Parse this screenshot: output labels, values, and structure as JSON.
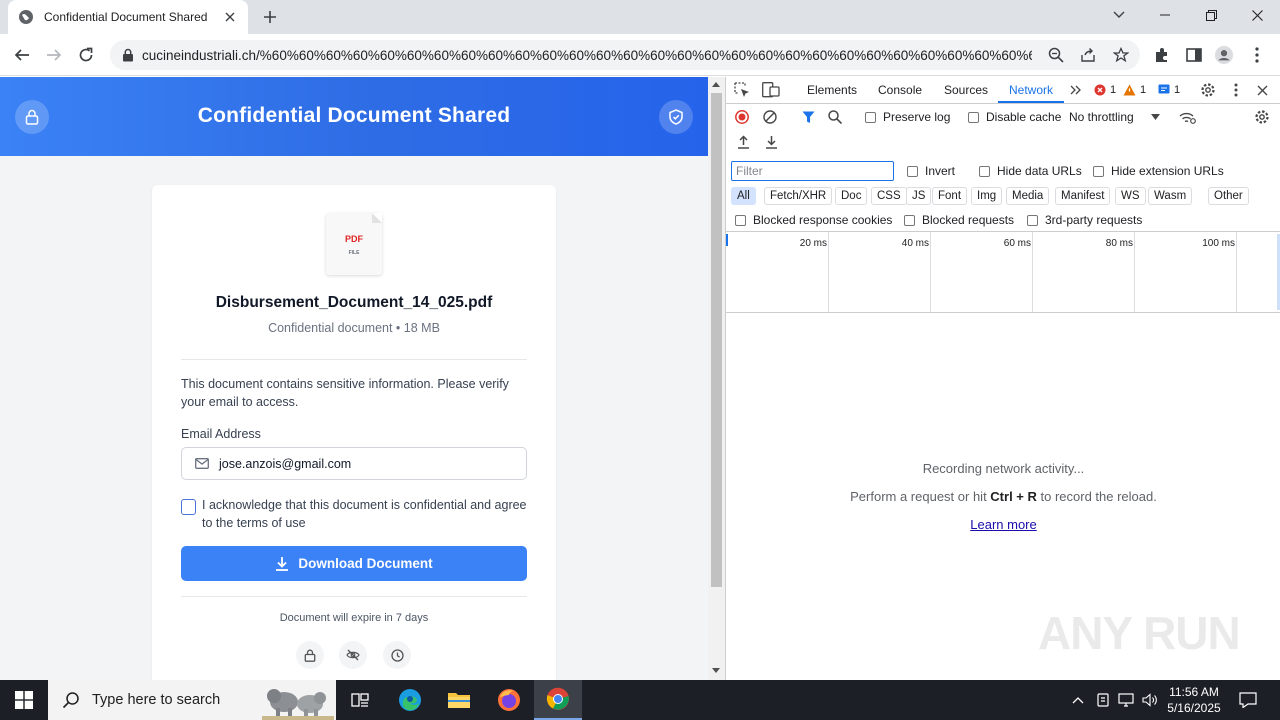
{
  "browser": {
    "tab_title": "Confidential Document Shared",
    "url": "cucineindustriali.ch/%60%60%60%60%60%60%60%60%60%60%60%60%60%60%60%60%60%60%60%60%60%60%60%60%60%60%60%60%60%..."
  },
  "page": {
    "header_title": "Confidential Document Shared",
    "pdf_label": "PDF",
    "file_label": "FILE",
    "file_name": "Disbursement_Document_14_025.pdf",
    "file_meta": "Confidential document • 18 MB",
    "info_text": "This document contains sensitive information. Please verify your email to access.",
    "email_label": "Email Address",
    "email_value": "jose.anzois@gmail.com",
    "ack_text": "I acknowledge that this document is confidential and agree to the terms of use",
    "download_label": "Download Document",
    "expire_text": "Document will expire in 7 days",
    "accent_color": "#3b82f6"
  },
  "devtools": {
    "tabs": [
      "Elements",
      "Console",
      "Sources",
      "Network"
    ],
    "active_tab": "Network",
    "errors": "1",
    "warnings": "1",
    "messages": "1",
    "preserve_log": "Preserve log",
    "disable_cache": "Disable cache",
    "throttling": "No throttling",
    "filter_placeholder": "Filter",
    "invert": "Invert",
    "hide_data_urls": "Hide data URLs",
    "hide_extension_urls": "Hide extension URLs",
    "chips": [
      "All",
      "Fetch/XHR",
      "Doc",
      "CSS",
      "JS",
      "Font",
      "Img",
      "Media",
      "Manifest",
      "WS",
      "Wasm",
      "Other"
    ],
    "blocked_cookies": "Blocked response cookies",
    "blocked_requests": "Blocked requests",
    "third_party": "3rd-party requests",
    "timeline_labels": [
      "20 ms",
      "40 ms",
      "60 ms",
      "80 ms",
      "100 ms"
    ],
    "recording": "Recording network activity...",
    "perform_pre": "Perform a request or hit ",
    "perform_keys": "Ctrl + R",
    "perform_post": " to record the reload.",
    "learn_more": "Learn more"
  },
  "watermark": "ANY RUN",
  "taskbar": {
    "search_placeholder": "Type here to search",
    "time": "11:56 AM",
    "date": "5/16/2025"
  }
}
